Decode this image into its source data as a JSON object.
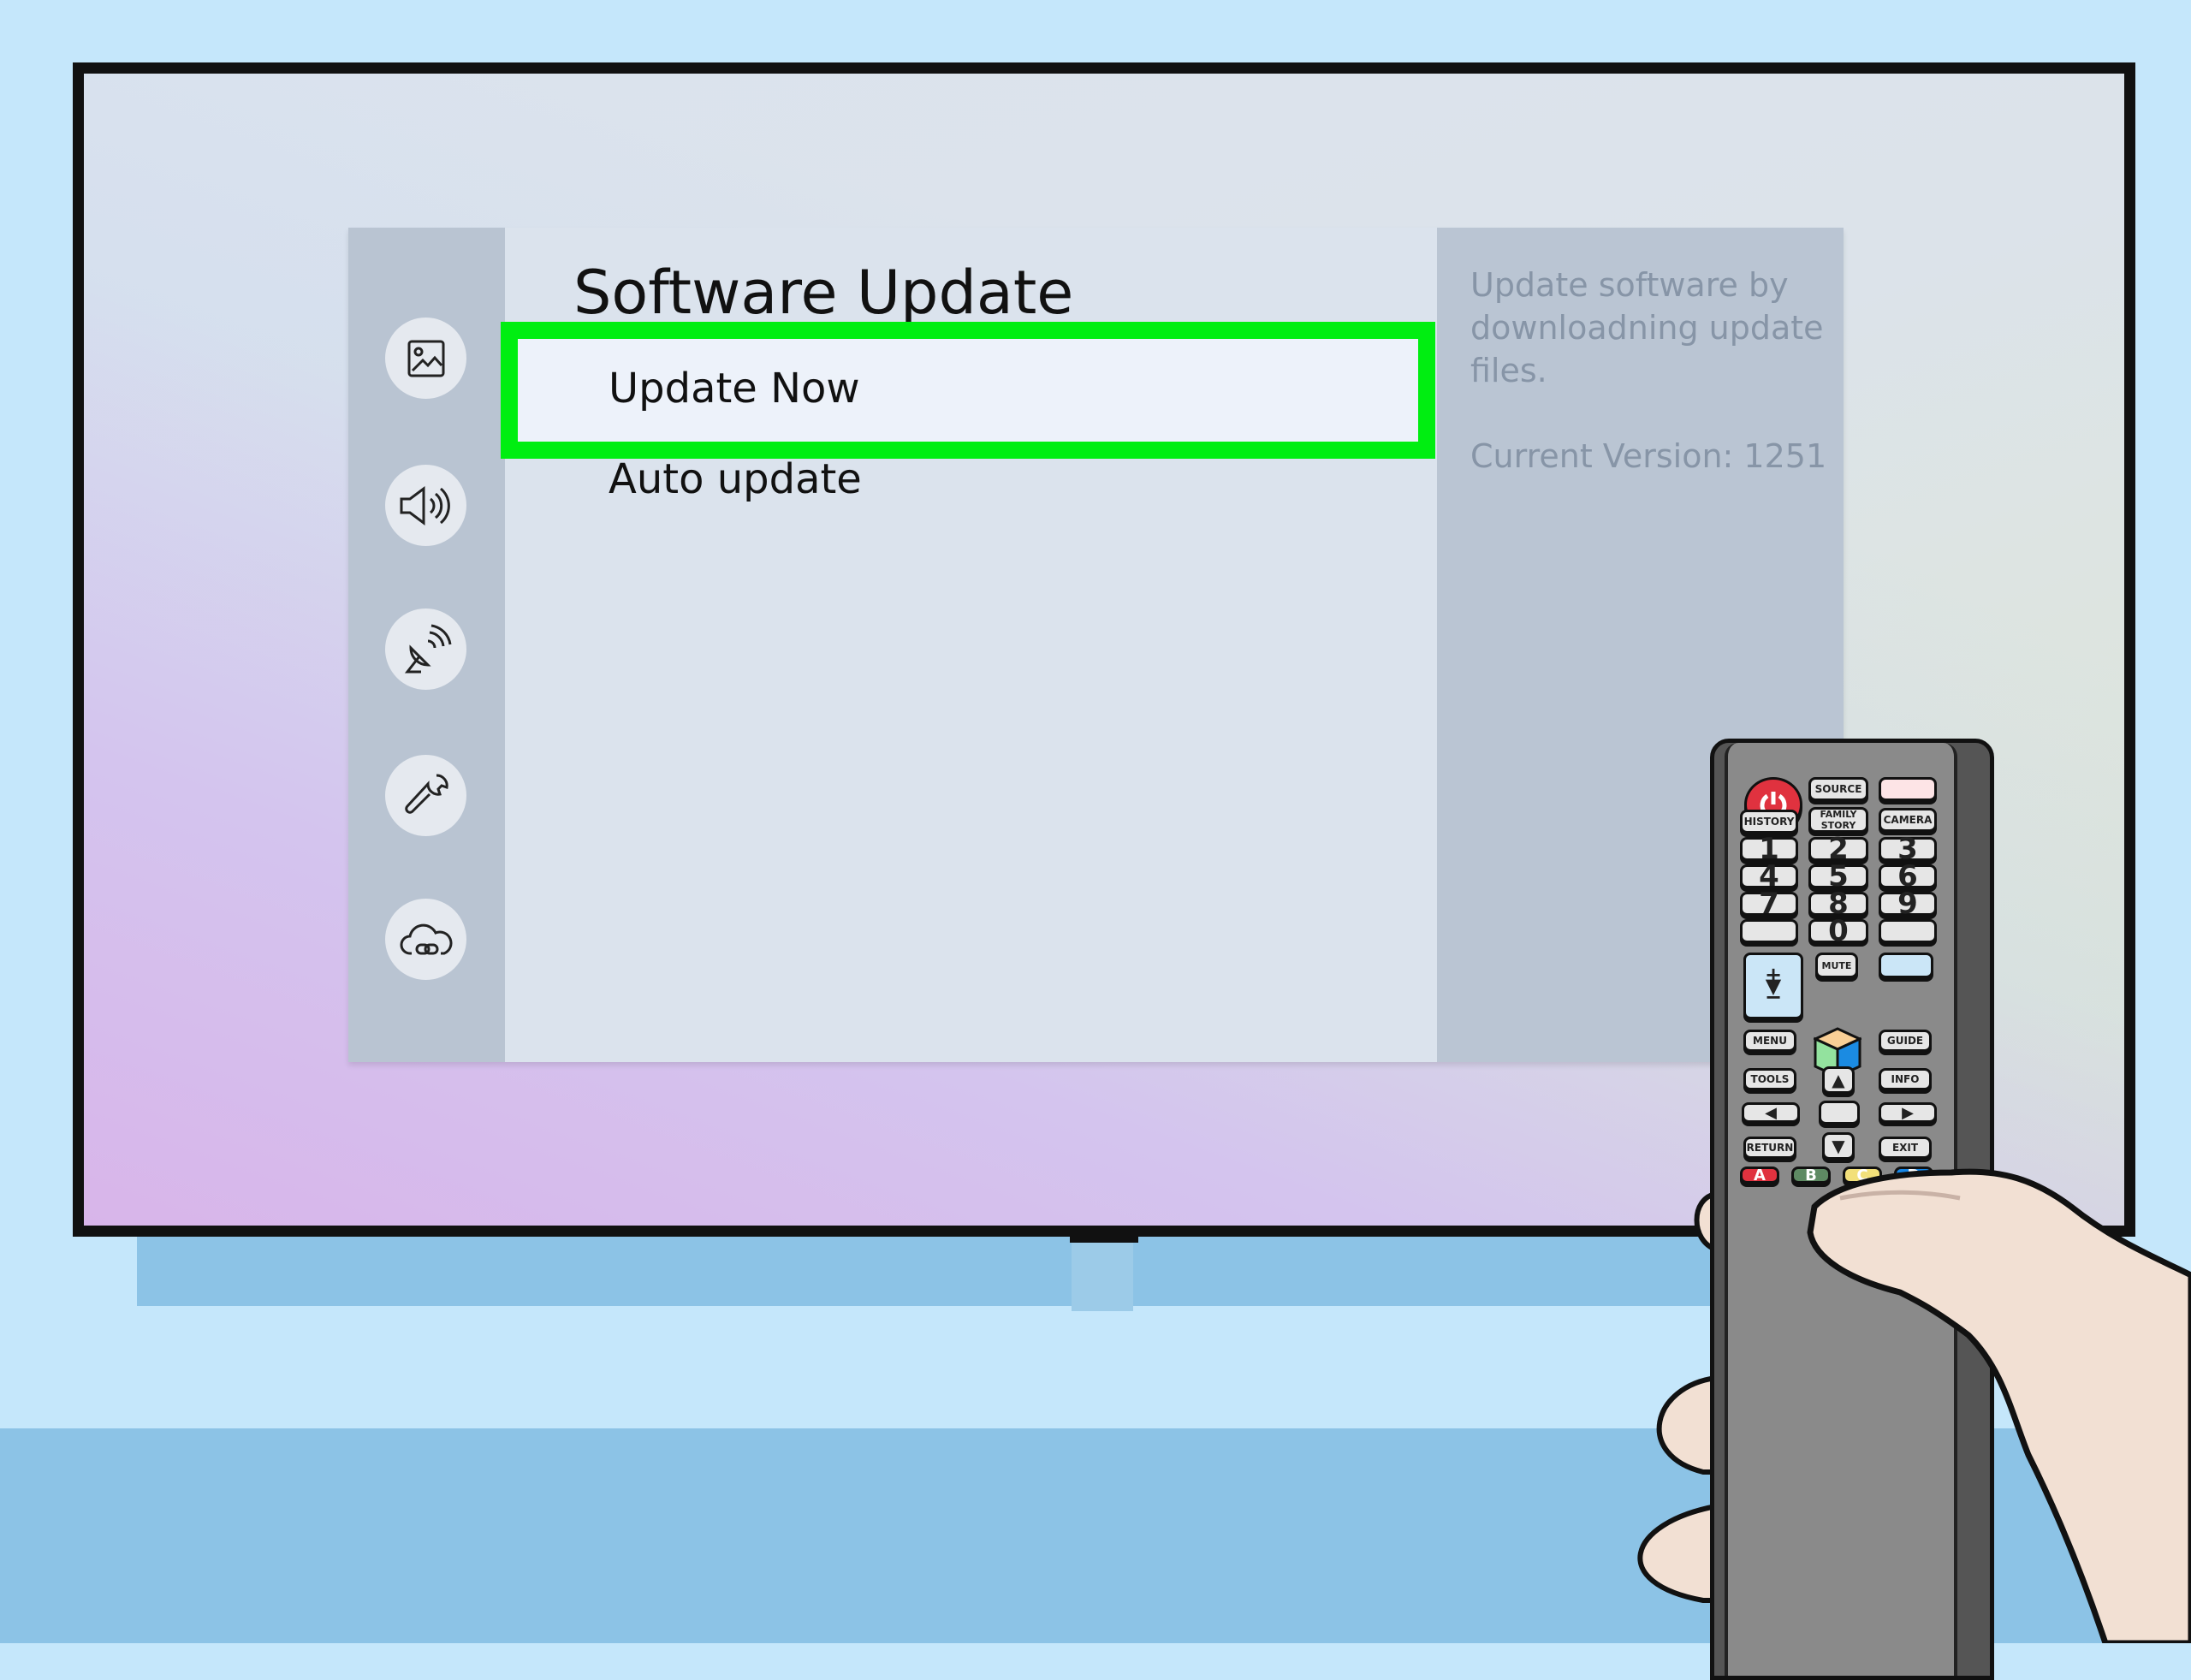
{
  "menu": {
    "title": "Software Update",
    "items": [
      {
        "label": "Update Now",
        "selected": true
      },
      {
        "label": "Auto update",
        "selected": false
      }
    ],
    "sidebar_icons": [
      "picture-icon",
      "sound-icon",
      "broadcast-icon",
      "support-wrench-icon",
      "cloud-link-icon"
    ],
    "info": {
      "lines": [
        "Update software by",
        "downloadning update",
        "files."
      ],
      "version": "Current Version: 1251"
    },
    "highlight_color": "#00ee11"
  },
  "remote": {
    "top": [
      "SOURCE",
      "HISTORY",
      "FAMILY STORY",
      "CAMERA"
    ],
    "numbers": [
      "1",
      "2",
      "3",
      "4",
      "5",
      "6",
      "7",
      "8",
      "9",
      "0"
    ],
    "mute": "MUTE",
    "vol_plus": "+",
    "vol_minus": "−",
    "nav": [
      "MENU",
      "GUIDE",
      "TOOLS",
      "INFO",
      "RETURN",
      "EXIT"
    ],
    "colors": [
      {
        "label": "A",
        "color": "#e0323f"
      },
      {
        "label": "B",
        "color": "#5e8a63"
      },
      {
        "label": "C",
        "color": "#f2e07a"
      },
      {
        "label": "D",
        "color": "#1787e6"
      }
    ]
  }
}
